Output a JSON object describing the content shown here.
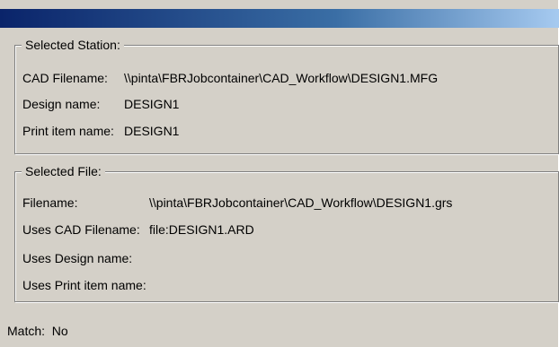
{
  "selected_station": {
    "legend": "Selected Station:",
    "cad_filename_label": "CAD Filename:",
    "cad_filename_value": "\\\\pinta\\FBRJobcontainer\\CAD_Workflow\\DESIGN1.MFG",
    "design_name_label": "Design name:",
    "design_name_value": "DESIGN1",
    "print_item_label": "Print item name:",
    "print_item_value": "DESIGN1"
  },
  "selected_file": {
    "legend": "Selected File:",
    "filename_label": "Filename:",
    "filename_value": "\\\\pinta\\FBRJobcontainer\\CAD_Workflow\\DESIGN1.grs",
    "uses_cad_label": "Uses CAD Filename:",
    "uses_cad_value": "file:DESIGN1.ARD",
    "uses_design_label": "Uses Design name:",
    "uses_print_label": "Uses Print item name:"
  },
  "match": {
    "text": "Match:  No"
  }
}
